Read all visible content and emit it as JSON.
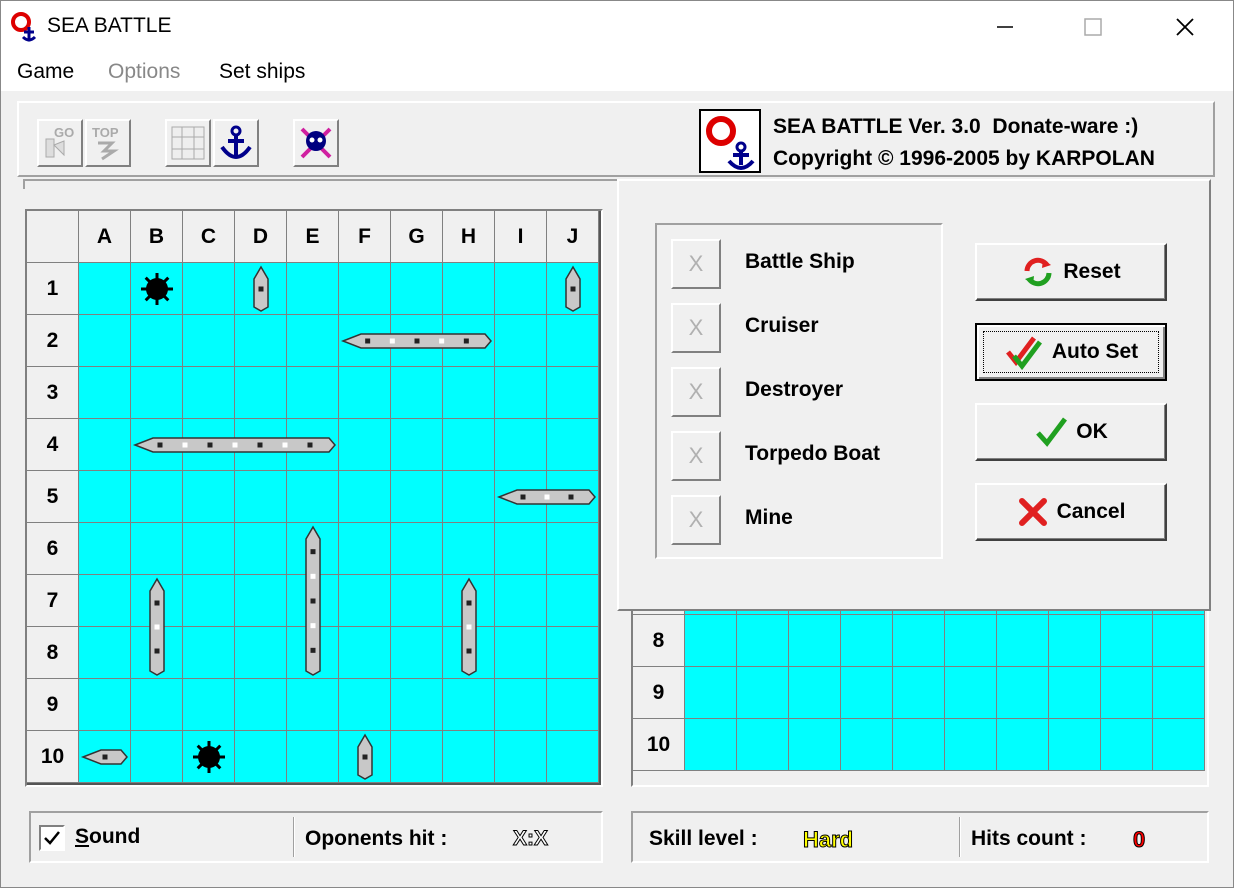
{
  "window": {
    "title": "SEA BATTLE",
    "min": "—",
    "max": "☐",
    "close": "✕"
  },
  "menu": [
    {
      "label": "Game",
      "enabled": true
    },
    {
      "label": "Options",
      "enabled": false
    },
    {
      "label": "Set ships",
      "enabled": true
    }
  ],
  "toolbar": {
    "icons": [
      "go-icon",
      "top-icon",
      "ships-setup-icon",
      "anchor-icon",
      "skull-icon"
    ],
    "about_line1": "SEA BATTLE Ver. 3.0  Donate-ware :)",
    "about_line2": "Copyright © 1996-2005 by KARPOLAN"
  },
  "board": {
    "columns": [
      "A",
      "B",
      "C",
      "D",
      "E",
      "F",
      "G",
      "H",
      "I",
      "J"
    ],
    "rows": [
      "1",
      "2",
      "3",
      "4",
      "5",
      "6",
      "7",
      "8",
      "9",
      "10"
    ]
  },
  "opponent_board": {
    "rows": [
      "8",
      "9",
      "10"
    ]
  },
  "dialog": {
    "items": [
      {
        "label": "Battle Ship",
        "x": "X"
      },
      {
        "label": "Cruiser",
        "x": "X"
      },
      {
        "label": "Destroyer",
        "x": "X"
      },
      {
        "label": "Torpedo Boat",
        "x": "X"
      },
      {
        "label": "Mine",
        "x": "X"
      }
    ],
    "buttons": {
      "reset": "Reset",
      "auto_set": "Auto Set",
      "ok": "OK",
      "cancel": "Cancel"
    }
  },
  "status": {
    "sound_label": "Sound",
    "sound_checked": true,
    "opponents_hit_label": "Oponents hit :",
    "opponents_hit_value": "X:X",
    "skill_label": "Skill level :",
    "skill_value": "Hard",
    "hits_label": "Hits count :",
    "hits_value": "0"
  },
  "colors": {
    "water": "#00ffff",
    "skill": "#ffff00",
    "hits": "#ff0000"
  }
}
